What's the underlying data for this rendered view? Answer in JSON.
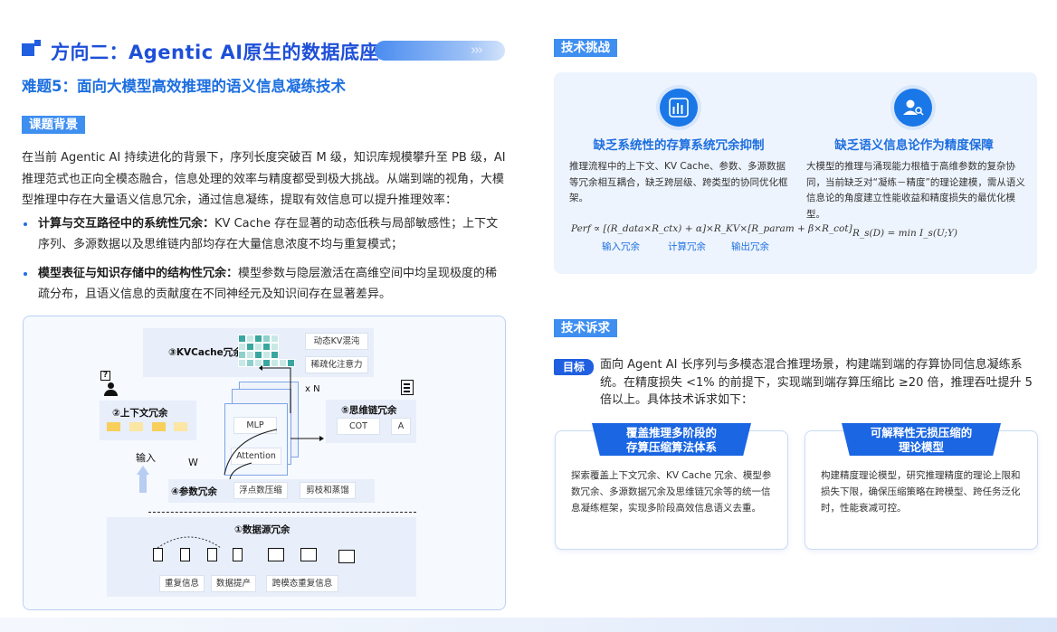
{
  "header": {
    "title": "方向二：Agentic AI原生的数据底座",
    "arrows": "›››",
    "subtitle": "难题5：面向大模型高效推理的语义信息凝练技术"
  },
  "background": {
    "tag": "课题背景",
    "paragraph": "在当前 Agentic AI 持续进化的背景下，序列长度突破百 M 级，知识库规模攀升至 PB 级，AI 推理范式也正向全模态融合，信息处理的效率与精度都受到极大挑战。从端到端的视角，大模型推理中存在大量语义信息冗余，通过信息凝练，提取有效信息可以提升推理效率：",
    "bullets": [
      {
        "bold": "计算与交互路径中的系统性冗余：",
        "text": "KV Cache 存在显著的动态低秩与局部敏感性；上下文序列、多源数据以及思维链内部均存在大量信息浓度不均与重复模式；"
      },
      {
        "bold": "模型表征与知识存储中的结构性冗余：",
        "text": "模型参数与隐层激活在高维空间中均呈现极度的稀疏分布，且语义信息的贡献度在不同神经元及知识间存在显著差异。"
      }
    ]
  },
  "diagram": {
    "kvcache_label": "③KVCache冗余",
    "kv_chip1": "动态KV混沌",
    "kv_chip2": "稀疏化注意力",
    "context_label": "②上下文冗余",
    "input_label": "输入",
    "w_label": "W",
    "mlp_label": "MLP",
    "attention_label": "Attention",
    "xn_label": "x N",
    "cot_region_label": "⑤思维链冗余",
    "cot_chip": "COT",
    "a_chip": "A",
    "param_label": "④参数冗余",
    "param_chip1": "浮点数压缩",
    "param_chip2": "剪枝和蒸馏",
    "datasource_label": "①数据源冗余",
    "ds_chip1": "重复信息",
    "ds_chip2": "数据提产",
    "ds_chip3": "跨模态重复信息",
    "question_mark": "?",
    "colors": {
      "accent": "#1f5fe0",
      "cell_dark": "#3aa6a0",
      "cell_light": "#c8e8e6",
      "context_chip": "#f7cf5a"
    }
  },
  "challenges": {
    "tag": "技术挑战",
    "items": [
      {
        "icon": "bar-chart-icon",
        "title": "缺乏系统性的存算系统冗余抑制",
        "text": "推理流程中的上下文、KV Cache、参数、多源数据等冗余相互耦合，缺乏跨层级、跨类型的协同优化框架。",
        "formula": "Perf ∝ [(R_data×R_ctx) + α]×R_KV×[R_param + β×R_cot]",
        "labels": [
          "输入冗余",
          "计算冗余",
          "输出冗余"
        ]
      },
      {
        "icon": "user-search-icon",
        "title": "缺乏语义信息论作为精度保障",
        "text": "大模型的推理与涌现能力根植于高维参数的复杂协同，当前缺乏对“凝练－精度”的理论建模，需从语义信息论的角度建立性能收益和精度损失的最优化模型。",
        "formula": "R_s(D) = min I_s(U;Y)"
      }
    ]
  },
  "requirements": {
    "tag": "技术诉求",
    "goal_tag": "目标",
    "goal_text": "面向 Agent AI 长序列与多模态混合推理场景，构建端到端的存算协同信息凝练系统。在精度损失 <1% 的前提下，实现端到端存算压缩比 ≥20 倍，推理吞吐提升 5 倍以上。具体技术诉求如下：",
    "cards": [
      {
        "title_line1": "覆盖推理多阶段的",
        "title_line2": "存算压缩算法体系",
        "text": "探索覆盖上下文冗余、KV Cache 冗余、模型参数冗余、多源数据冗余及思维链冗余等的统一信息凝练框架，实现多阶段高效信息语义去重。"
      },
      {
        "title_line1": "可解释性无损压缩的",
        "title_line2": "理论模型",
        "text": "构建精度理论模型，研究推理精度的理论上限和损失下限，确保压缩策略在跨模型、跨任务泛化时，性能衰减可控。"
      }
    ]
  }
}
